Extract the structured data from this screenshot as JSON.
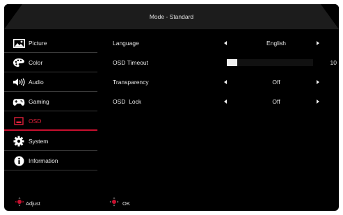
{
  "header": {
    "title": "Mode - Standard"
  },
  "sidebar": {
    "items": [
      {
        "label": "Picture",
        "icon": "picture-icon"
      },
      {
        "label": "Color",
        "icon": "palette-icon"
      },
      {
        "label": "Audio",
        "icon": "speaker-icon"
      },
      {
        "label": "Gaming",
        "icon": "gamepad-icon"
      },
      {
        "label": "OSD",
        "icon": "osd-icon",
        "active": true
      },
      {
        "label": "System",
        "icon": "gear-icon"
      },
      {
        "label": "Information",
        "icon": "info-icon"
      }
    ]
  },
  "settings": {
    "language": {
      "label": "Language",
      "value": "English"
    },
    "osd_timeout": {
      "label": "OSD Timeout",
      "value": "10",
      "level": 0.12
    },
    "transparency": {
      "label": "Transparency",
      "value": "Off"
    },
    "osd_lock": {
      "label": "OSD  Lock",
      "value": "Off"
    }
  },
  "footer": {
    "adjust_label": "Adjust",
    "ok_label": "OK"
  },
  "colors": {
    "accent": "#c8102e",
    "background": "#000000",
    "header": "#1c1c1c"
  }
}
